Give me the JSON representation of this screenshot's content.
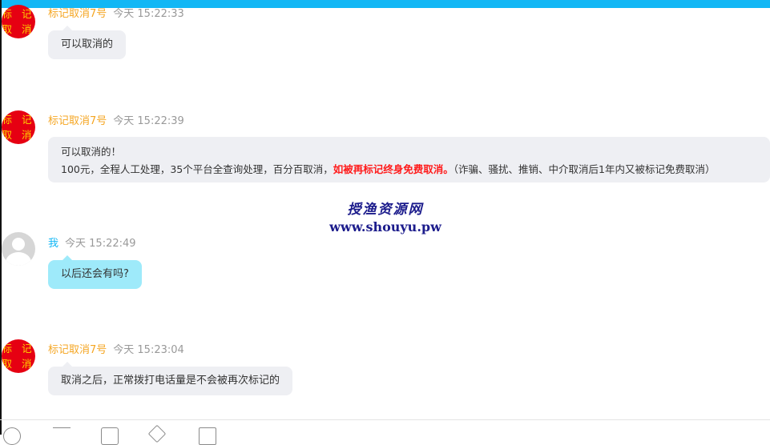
{
  "colors": {
    "accent": "#12b7f5",
    "sender_name": "#f5a623",
    "my_name": "#12b7f5",
    "bubble_other": "#eeeff3",
    "bubble_mine": "#9eeafa",
    "highlight": "#ff1a1a"
  },
  "avatar_badge": {
    "line1": "标 记",
    "line2": "取 消"
  },
  "messages": [
    {
      "sender": "标记取消7号",
      "time": "今天 15:22:33",
      "text": "可以取消的"
    },
    {
      "sender": "标记取消7号",
      "time": "今天 15:22:39",
      "line1": "可以取消的！",
      "line2_a": "100元，全程人工处理，35个平台全查询处理，百分百取消，",
      "line2_highlight": "如被再标记终身免费取消。",
      "line2_b": "（诈骗、骚扰、推销、中介取消后1年内又被标记免费取消）"
    },
    {
      "sender": "我",
      "time": "今天 15:22:49",
      "text": "以后还会有吗?"
    },
    {
      "sender": "标记取消7号",
      "time": "今天 15:23:04",
      "text": "取消之后，正常拨打电话量是不会被再次标记的"
    }
  ],
  "watermark": {
    "title": "授渔资源网",
    "url": "www.shouyu.pw"
  },
  "toolbar": {
    "icons": [
      "emoji-icon",
      "font-icon",
      "screenshot-icon",
      "scissors-icon",
      "folder-icon"
    ]
  }
}
